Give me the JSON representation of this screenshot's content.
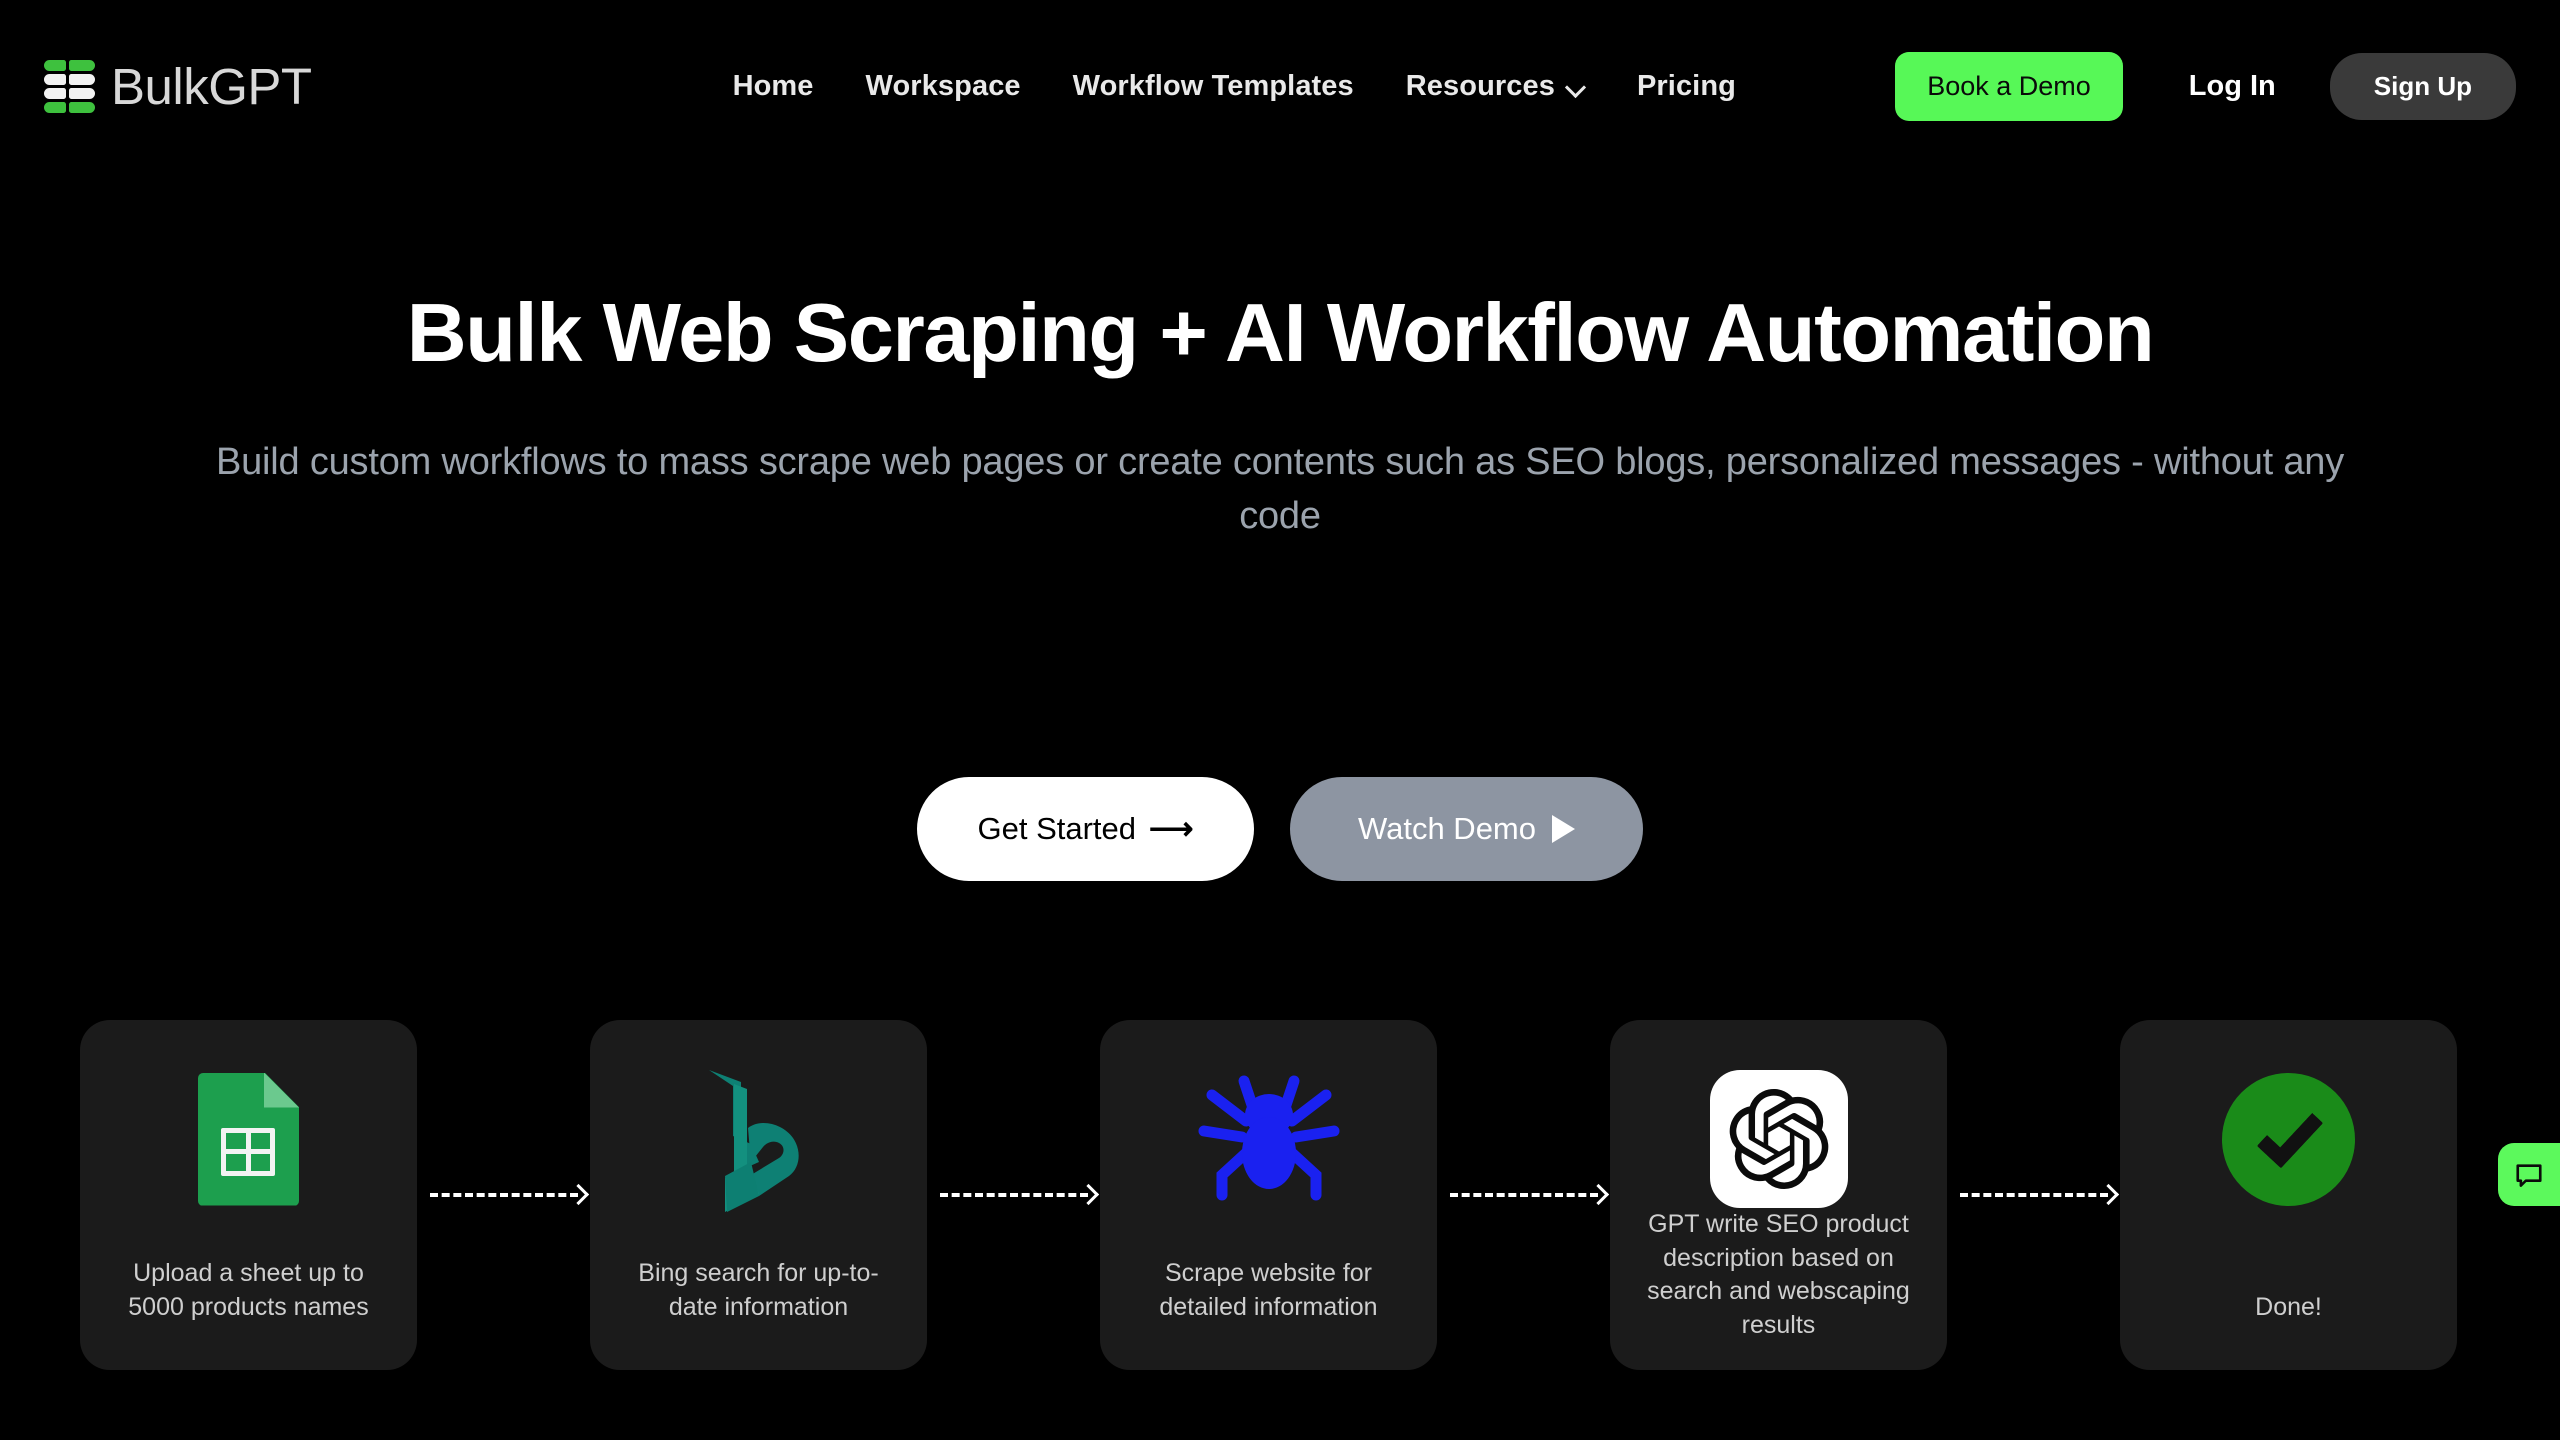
{
  "brand": {
    "name": "BulkGPT",
    "logo_colors": {
      "green": "#3ec13e",
      "white": "#f2f2f2"
    }
  },
  "nav": {
    "links": [
      {
        "label": "Home",
        "has_chevron": false
      },
      {
        "label": "Workspace",
        "has_chevron": false
      },
      {
        "label": "Workflow Templates",
        "has_chevron": false
      },
      {
        "label": "Resources",
        "has_chevron": true
      },
      {
        "label": "Pricing",
        "has_chevron": false
      }
    ],
    "demo_button": "Book a Demo",
    "login_label": "Log In",
    "signup_label": "Sign Up",
    "accent_green": "#57f857",
    "signup_bg": "#3a3a3a"
  },
  "hero": {
    "title": "Bulk Web Scraping + AI Workflow Automation",
    "subtitle": "Build custom workflows to mass scrape web pages or create contents such as SEO blogs, personalized messages - without any code",
    "primary_cta": "Get Started",
    "primary_cta_icon": "arrow-right-icon",
    "secondary_cta": "Watch Demo",
    "secondary_cta_icon": "play-icon",
    "secondary_cta_bg": "#8d95a2"
  },
  "workflow": {
    "steps": [
      {
        "icon": "google-sheets-icon",
        "label": "Upload a sheet up to 5000 products names",
        "color": "#1d9f4e"
      },
      {
        "icon": "bing-icon",
        "label": "Bing search for up-to-date information",
        "color": "#0e8074"
      },
      {
        "icon": "spider-icon",
        "label": "Scrape website for detailed information",
        "color": "#1a21f0"
      },
      {
        "icon": "openai-icon",
        "label": "GPT write SEO product description based on search and webscaping results",
        "color": "#000000"
      },
      {
        "icon": "check-circle-icon",
        "label": "Done!",
        "color": "#1a8b19"
      }
    ],
    "connector_icon": "dashed-arrow-icon",
    "card_bg": "#1b1b1b"
  },
  "chat_widget": {
    "icon": "chat-bubble-icon",
    "color": "#5cf95c"
  }
}
